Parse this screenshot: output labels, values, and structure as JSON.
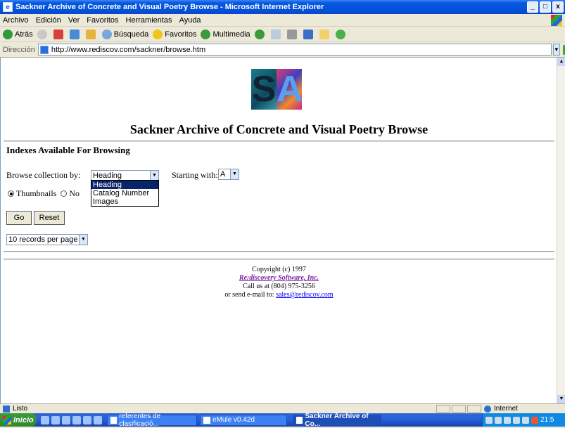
{
  "window": {
    "title": "Sackner Archive of Concrete and Visual Poetry Browse - Microsoft Internet Explorer",
    "controls": [
      "_",
      "□",
      "x"
    ]
  },
  "menu": [
    "Archivo",
    "Edición",
    "Ver",
    "Favoritos",
    "Herramientas",
    "Ayuda"
  ],
  "toolbar": {
    "back": "Atrás",
    "search": "Búsqueda",
    "favorites": "Favoritos",
    "multimedia": "Multimedia"
  },
  "address": {
    "label": "Dirección",
    "url": "http://www.rediscov.com/sackner/browse.htm",
    "go": "Ir"
  },
  "page": {
    "logo_left": "S",
    "logo_right": "A",
    "title": "Sackner Archive of Concrete and Visual Poetry Browse",
    "section_heading": "Indexes Available For Browsing",
    "browse_label": "Browse collection by:",
    "browse_selected": "Heading",
    "browse_options": [
      "Heading",
      "Catalog Number",
      "Images"
    ],
    "starting_label": "Starting with:",
    "starting_value": "A",
    "radio_thumbnails": "Thumbnails",
    "radio_no": "No",
    "go_button": "Go",
    "reset_button": "Reset",
    "records_select": "10 records per page"
  },
  "footer": {
    "copyright": "Copyright (c) 1997",
    "company": "Re:discovery Software, Inc.",
    "call": "Call us at (804) 975-3256",
    "email_prefix": "or send e-mail to:",
    "email": "sales@rediscov.com"
  },
  "status": {
    "text": "Listo",
    "zone": "Internet"
  },
  "taskbar": {
    "start": "Inicio",
    "tasks": [
      "referentes de clasificació...",
      "eMule v0.42d",
      "Sackner Archive of Co..."
    ],
    "clock": "21:5"
  }
}
